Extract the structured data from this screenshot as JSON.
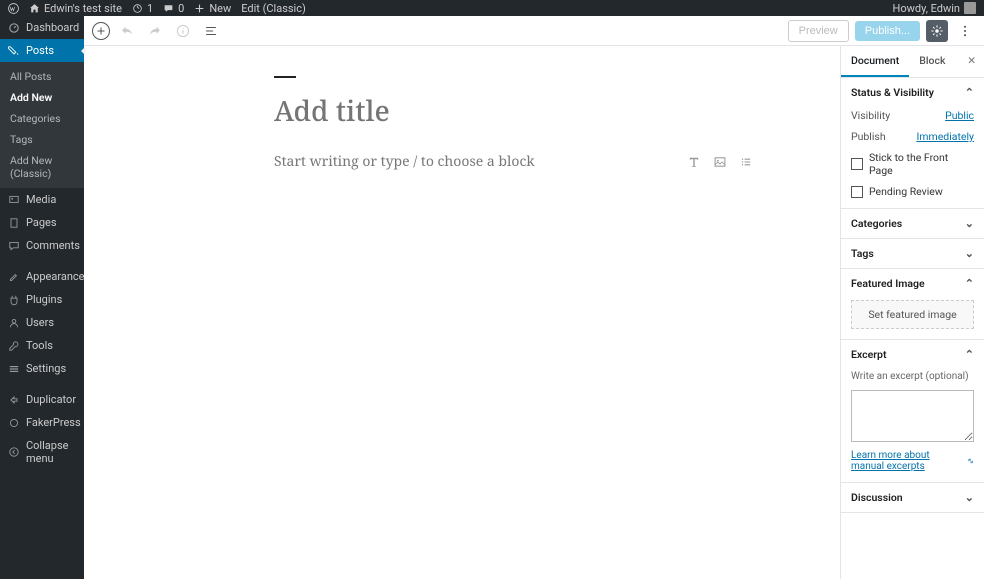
{
  "adminbar": {
    "site_name": "Edwin's test site",
    "updates": "1",
    "comments": "0",
    "new_label": "New",
    "edit_link": "Edit (Classic)",
    "howdy": "Howdy, Edwin"
  },
  "sidebar": {
    "dashboard": "Dashboard",
    "posts": "Posts",
    "posts_sub": {
      "all": "All Posts",
      "add": "Add New",
      "categories": "Categories",
      "tags": "Tags",
      "classic": "Add New (Classic)"
    },
    "media": "Media",
    "pages": "Pages",
    "comments": "Comments",
    "appearance": "Appearance",
    "plugins": "Plugins",
    "users": "Users",
    "tools": "Tools",
    "settings": "Settings",
    "duplicator": "Duplicator",
    "fakerpress": "FakerPress",
    "collapse": "Collapse menu"
  },
  "toolbar": {
    "preview": "Preview",
    "publish": "Publish..."
  },
  "editor": {
    "title_placeholder": "Add title",
    "paragraph_placeholder": "Start writing or type / to choose a block"
  },
  "settings": {
    "tab_document": "Document",
    "tab_block": "Block",
    "status_header": "Status & Visibility",
    "visibility_label": "Visibility",
    "visibility_value": "Public",
    "publish_label": "Publish",
    "publish_value": "Immediately",
    "stick": "Stick to the Front Page",
    "pending": "Pending Review",
    "categories": "Categories",
    "tags": "Tags",
    "featured": "Featured Image",
    "featured_btn": "Set featured image",
    "excerpt": "Excerpt",
    "excerpt_label": "Write an excerpt (optional)",
    "excerpt_link": "Learn more about manual excerpts",
    "discussion": "Discussion"
  }
}
